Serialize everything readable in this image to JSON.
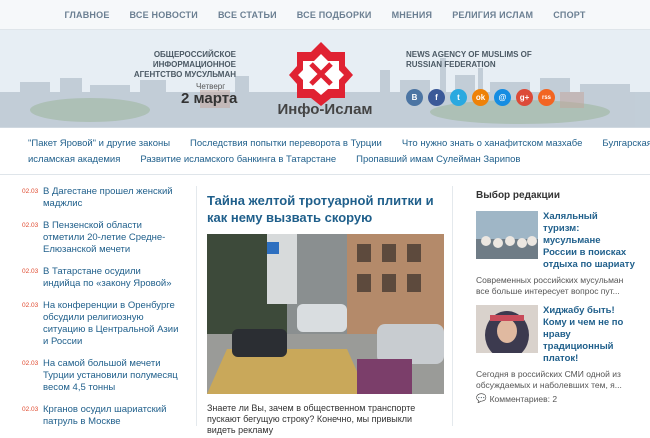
{
  "nav": [
    "ГЛАВНОЕ",
    "ВСЕ НОВОСТИ",
    "ВСЕ СТАТЬИ",
    "ВСЕ ПОДБОРКИ",
    "МНЕНИЯ",
    "РЕЛИГИЯ ИСЛАМ",
    "СПОРТ"
  ],
  "header": {
    "tagline_left": "ОБЩЕРОССИЙСКОЕ ИНФОРМАЦИОННОЕ АГЕНТСТВО МУСУЛЬМАН",
    "tagline_right": "NEWS AGENCY OF MUSLIMS OF RUSSIAN FEDERATION",
    "weekday": "Четверг",
    "date": "2 марта",
    "logo_text": "Инфо-Ислам",
    "brand_color": "#e02232",
    "socials": [
      {
        "icon": "vk-icon",
        "glyph": "B",
        "color": "#4c75a3"
      },
      {
        "icon": "facebook-icon",
        "glyph": "f",
        "color": "#3b5998"
      },
      {
        "icon": "twitter-icon",
        "glyph": "t",
        "color": "#2aa9e0"
      },
      {
        "icon": "odnoklassniki-icon",
        "glyph": "ok",
        "color": "#ee8208"
      },
      {
        "icon": "mailru-icon",
        "glyph": "@",
        "color": "#168de2"
      },
      {
        "icon": "googleplus-icon",
        "glyph": "g+",
        "color": "#dc4a38"
      },
      {
        "icon": "rss-icon",
        "glyph": "rss",
        "color": "#f26522"
      }
    ]
  },
  "tags": {
    "row1": [
      "\"Пакет Яровой\" и другие законы",
      "Последствия попытки переворота в Турции",
      "Что нужно знать о ханафитском мазхабе",
      "Булгарская"
    ],
    "row2": [
      "исламская академия",
      "Развитие исламского банкинга в Татарстане",
      "Пропавший имам Сулейман Зарипов"
    ]
  },
  "news": [
    {
      "date": "02.03",
      "title": "В Дагестане прошел женский маджлис"
    },
    {
      "date": "02.03",
      "title": "В Пензенской области отметили 20-летие Средне-Елюзанской мечети"
    },
    {
      "date": "02.03",
      "title": "В Татарстане осудили индийца по «закону Яровой»"
    },
    {
      "date": "02.03",
      "title": "На конференции в Оренбурге обсудили религиозную ситуацию в Центральной Азии и России"
    },
    {
      "date": "02.03",
      "title": "На самой большой мечети Турции установили полумесяц весом 4,5 тонны"
    },
    {
      "date": "02.03",
      "title": "Крганов осудил шариатский патруль в Москве"
    }
  ],
  "main": {
    "title": "Тайна желтой тротуарной плитки и как нему вызвать скорую",
    "lead": "Знаете ли Вы, зачем в общественном транспорте пускают бегущую строку? Конечно, мы привыкли видеть рекламу"
  },
  "editor": {
    "heading": "Выбор редакции",
    "items": [
      {
        "title": "Халяльный туризм: мусульмане России в поисках отдыха по шариату",
        "text": "Современных российских мусульман все больше интересует вопрос пут..."
      },
      {
        "title": "Хиджабу быть! Кому и чем не по нраву традиционный платок!",
        "text": "Сегодня в российских СМИ одной из обсуждаемых и наболевших тем, я...",
        "comments": "Комментариев: 2"
      }
    ]
  }
}
